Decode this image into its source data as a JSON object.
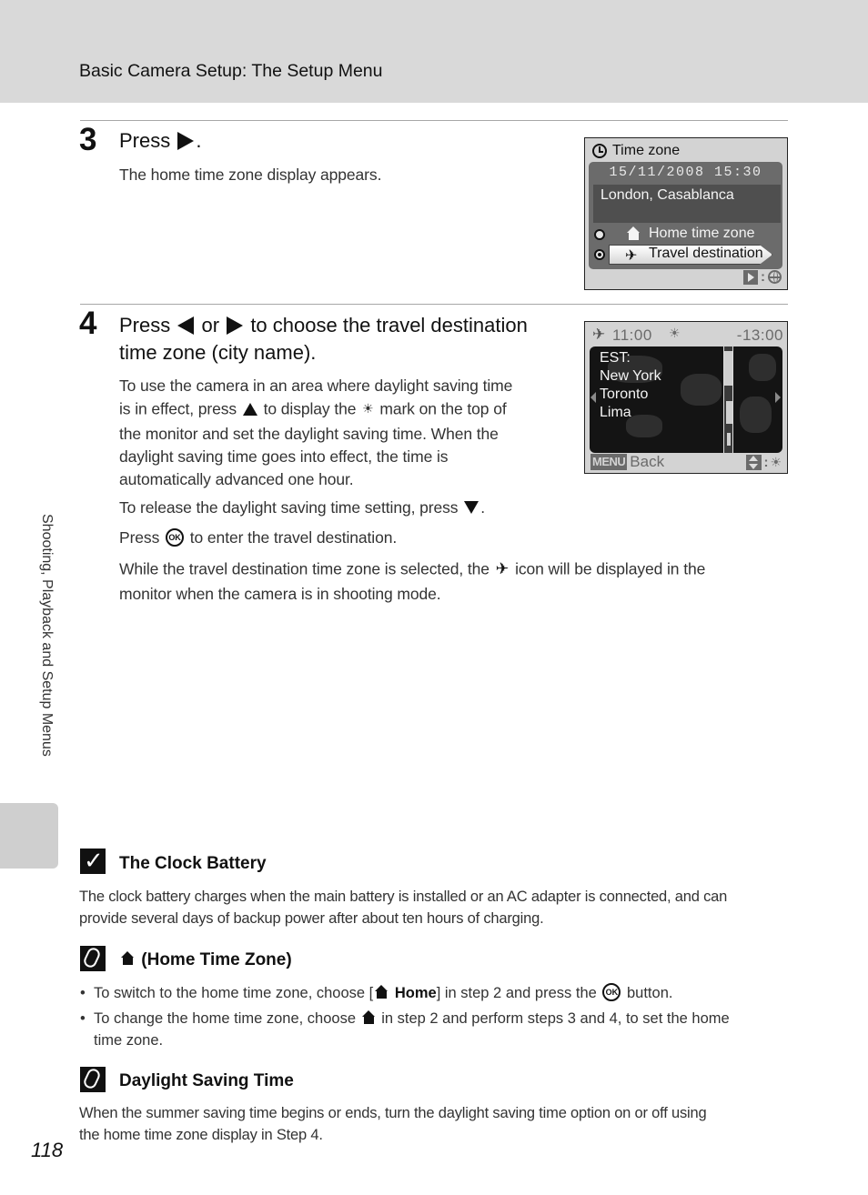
{
  "header": {
    "title": "Basic Camera Setup: The Setup Menu"
  },
  "side_tab": {
    "label": "Shooting, Playback and Setup Menus"
  },
  "steps": [
    {
      "number": "3",
      "title_prefix": "Press",
      "title_suffix": ".",
      "body": "The home time zone display appears."
    },
    {
      "number": "4",
      "title_part1": "Press",
      "title_part2": "or",
      "title_part3": "to choose the travel destination",
      "title_line2": "time zone (city name).",
      "para1_a": "To use the camera in an area where daylight saving time",
      "para1_b_pre": "is in effect, press",
      "para1_b_mid": "to display the",
      "para1_b_post": "mark on the top of",
      "para1_c": "the monitor and set the daylight saving time. When the",
      "para1_d": "daylight saving time goes into effect, the time is",
      "para1_e": "automatically advanced one hour.",
      "para2_pre": "To release the daylight saving time setting, press",
      "para2_post": ".",
      "para3_pre": "Press",
      "para3_post": "to enter the travel destination.",
      "para4_pre": "While the travel destination time zone is selected, the",
      "para4_post": "icon will be displayed in the",
      "para4_line2": "monitor when the camera is in shooting mode."
    }
  ],
  "screen1": {
    "title": "Time zone",
    "datetime": "15/11/2008 15:30",
    "city": "London, Casablanca",
    "options": [
      {
        "label": "Home time zone",
        "selected": false
      },
      {
        "label": "Travel destination",
        "selected": true
      }
    ]
  },
  "screen2": {
    "time": "11:00",
    "offset": "-13:00",
    "cities": [
      "EST:",
      "New York",
      "Toronto",
      "Lima"
    ],
    "menu_badge": "MENU",
    "back_label": "Back"
  },
  "notes": [
    {
      "icon": "check-icon",
      "heading": "The Clock Battery",
      "body_line1": "The clock battery charges when the main battery is installed or an AC adapter is connected, and can",
      "body_line2": "provide several days of backup power after about ten hours of charging."
    },
    {
      "icon": "pencil-icon",
      "heading": "(Home Time Zone)",
      "bullets": [
        {
          "pre": "To switch to the home time zone, choose [",
          "bold": "Home",
          "mid": "] in step 2 and press the",
          "post": "button."
        },
        {
          "pre": "To change the home time zone, choose",
          "post": "in step 2 and perform steps 3 and 4, to set the home",
          "line2": "time zone."
        }
      ]
    },
    {
      "icon": "pencil-icon",
      "heading": "Daylight Saving Time",
      "body_line1": "When the summer saving time begins or ends, turn the daylight saving time option on or off using",
      "body_line2": "the home time zone display in Step 4."
    }
  ],
  "page_number": "118",
  "glyphs": {
    "ok": "OK",
    "plane": "✈",
    "dst": "☀",
    "bullet": "•"
  }
}
